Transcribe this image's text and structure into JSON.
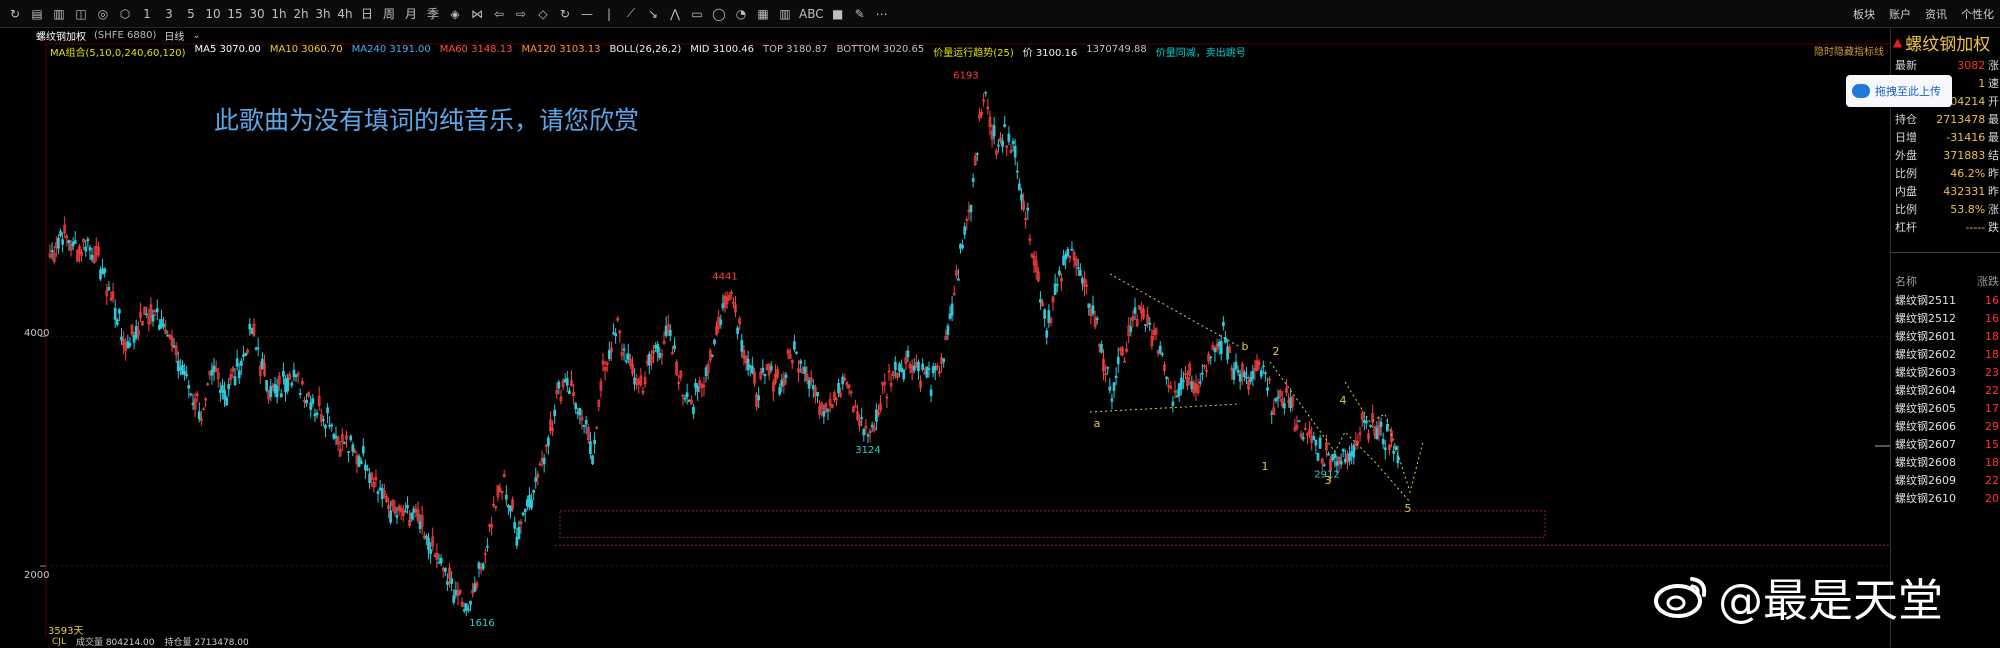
{
  "toolbar": {
    "buttons": [
      "↻",
      "▤",
      "▥",
      "◫",
      "◎",
      "⬡",
      "1",
      "3",
      "5",
      "10",
      "15",
      "30",
      "1h",
      "2h",
      "3h",
      "4h",
      "日",
      "周",
      "月",
      "季",
      "◈",
      "⋈",
      "⇦",
      "⇨",
      "◇",
      "↻",
      "—",
      "|",
      "⟋",
      "↘",
      "⋀",
      "▭",
      "◯",
      "◔",
      "▦",
      "▥",
      "ABC",
      "■",
      "✎",
      "⋯"
    ],
    "right": [
      "板块",
      "账户",
      "资讯",
      "个性化"
    ]
  },
  "subbar": {
    "name": "螺纹钢加权",
    "code": "(SHFE 6880)",
    "period": "日线"
  },
  "ma_line": [
    {
      "text": "MA组合(5,10,0,240,60,120)",
      "color": "#e0e000"
    },
    {
      "text": "MA5 3070.00",
      "color": "#ffffff"
    },
    {
      "text": "MA10 3060.70",
      "color": "#f0d020"
    },
    {
      "text": "MA240 3191.00",
      "color": "#3cb0ff"
    },
    {
      "text": "MA60 3148.13",
      "color": "#ff5050"
    },
    {
      "text": "MA120 3103.13",
      "color": "#ff9933"
    },
    {
      "text": "BOLL(26,26,2)",
      "color": "#f0f0f0"
    },
    {
      "text": "MID 3100.46",
      "color": "#f0f0f0"
    },
    {
      "text": "TOP 3180.87",
      "color": "#c0c0c0"
    },
    {
      "text": "BOTTOM 3020.65",
      "color": "#c0c0c0"
    },
    {
      "text": "价量运行趋势(25)",
      "color": "#e0e000"
    },
    {
      "text": "价 3100.16",
      "color": "#f0f0f0"
    },
    {
      "text": "1370749.88",
      "color": "#c0c0c0"
    },
    {
      "text": "价量同减，卖出跳号",
      "color": "#00d0d0"
    }
  ],
  "top_right_label": "隐时隐藏指标线",
  "overlay_text": "此歌曲为没有填词的纯音乐，请您欣赏",
  "yaxis": [
    "4000",
    "2000"
  ],
  "days": "3593天",
  "bottombar": {
    "cjl": "CJL",
    "vol": "成交量 804214.00",
    "oi": "持仓量 2713478.00"
  },
  "chart_data": {
    "type": "candlestick",
    "ylim": [
      1600,
      6300
    ],
    "ylabels": [
      "4000",
      "2000"
    ],
    "price_marks": [
      {
        "label": "6193",
        "value": 6193,
        "color": "#ff4040"
      },
      {
        "label": "4441",
        "value": 4441,
        "color": "#ff4040"
      },
      {
        "label": "3124",
        "value": 3124,
        "color": "#30d0d0"
      },
      {
        "label": "1616",
        "value": 1616,
        "color": "#30d0d0"
      },
      {
        "label": "2912",
        "value": 2912,
        "color": "#30d0d0"
      }
    ],
    "wave_labels": [
      "a",
      "b",
      "1",
      "2",
      "3",
      "4",
      "5"
    ],
    "series": [
      {
        "values": [
          4700,
          4900,
          4750,
          4850,
          4600,
          4300,
          3900,
          4100,
          4200,
          4150,
          3800,
          3600,
          3300,
          3700,
          3500,
          3750,
          4050,
          3650,
          3500,
          3700,
          3550,
          3400,
          3300,
          3100,
          3000,
          2900,
          2700,
          2500,
          2450,
          2400,
          2200,
          2000,
          1800,
          1616,
          1950,
          2400,
          2750,
          2300,
          2600,
          2900,
          3400,
          3650,
          3300,
          3000,
          3800,
          4050,
          3700,
          3600,
          3900,
          4000,
          3600,
          3400,
          3700,
          4100,
          4441,
          3900,
          3500,
          3700,
          3600,
          3900,
          3700,
          3400,
          3500,
          3600,
          3300,
          3124,
          3500,
          3700,
          3800,
          3700,
          3600,
          3900,
          4600,
          5200,
          6193,
          5600,
          5800,
          5300,
          4700,
          4100,
          4500,
          4800,
          4400,
          4100,
          3500,
          3800,
          4200,
          4100,
          3900,
          3500,
          3700,
          3600,
          3800,
          4000,
          3700,
          3600,
          3700,
          3400,
          3500,
          3200,
          3100,
          3000,
          2950,
          2912,
          3300,
          3200,
          3100,
          3000
        ]
      }
    ]
  },
  "right_panel": {
    "title": "螺纹钢加权",
    "quotes": [
      {
        "k": "最新",
        "v": "3082",
        "k2": "涨",
        "color": "#ff3030"
      },
      {
        "k": "现手",
        "v": "1",
        "k2": "速",
        "color": "#f0c040"
      },
      {
        "k": "总手",
        "v": "804214",
        "k2": "开",
        "color": "#f0c040"
      },
      {
        "k": "持仓",
        "v": "2713478",
        "k2": "最",
        "color": "#f0c040"
      },
      {
        "k": "日增",
        "v": "-31416",
        "k2": "最",
        "color": "#f0c040"
      },
      {
        "k": "外盘",
        "v": "371883",
        "k2": "结",
        "color": "#f0c040"
      },
      {
        "k": "比例",
        "v": "46.2%",
        "k2": "昨",
        "color": "#f0c040"
      },
      {
        "k": "内盘",
        "v": "432331",
        "k2": "昨",
        "color": "#f0c040"
      },
      {
        "k": "比例",
        "v": "53.8%",
        "k2": "涨",
        "color": "#f0c040"
      },
      {
        "k": "杠杆",
        "v": "-----",
        "k2": "跌",
        "color": "#f0c040"
      }
    ],
    "list_header": {
      "name": "名称",
      "change": "涨跌"
    },
    "list": [
      {
        "name": "螺纹钢2511",
        "change": "16"
      },
      {
        "name": "螺纹钢2512",
        "change": "16"
      },
      {
        "name": "螺纹钢2601",
        "change": "18"
      },
      {
        "name": "螺纹钢2602",
        "change": "18"
      },
      {
        "name": "螺纹钢2603",
        "change": "23"
      },
      {
        "name": "螺纹钢2604",
        "change": "22"
      },
      {
        "name": "螺纹钢2605",
        "change": "17"
      },
      {
        "name": "螺纹钢2606",
        "change": "29"
      },
      {
        "name": "螺纹钢2607",
        "change": "15"
      },
      {
        "name": "螺纹钢2608",
        "change": "18"
      },
      {
        "name": "螺纹钢2609",
        "change": "22"
      },
      {
        "name": "螺纹钢2610",
        "change": "20"
      }
    ]
  },
  "upload_popup": "拖拽至此上传",
  "watermark": "@最是天堂"
}
